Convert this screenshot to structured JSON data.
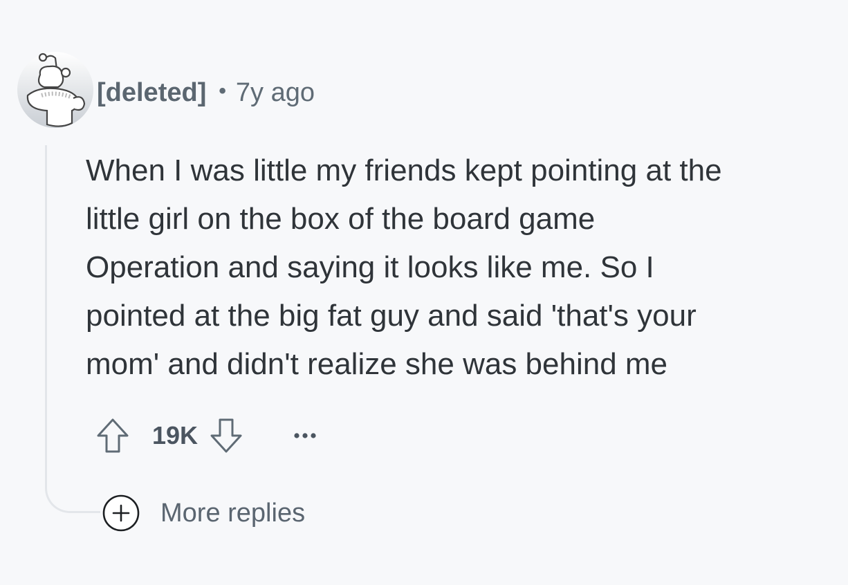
{
  "comment": {
    "author": "[deleted]",
    "separator": "•",
    "timestamp": "7y ago",
    "avatar_icon": "reddit-snoo-deleted-avatar",
    "body_lines": [
      "When I was little my friends kept pointing at the",
      "little girl on the box of the board game",
      "Operation and saying it looks like me. So I",
      "pointed at the big fat guy and said 'that's your",
      "mom' and didn't realize she was behind me"
    ]
  },
  "actions": {
    "upvote_icon": "upvote-arrow-icon",
    "score": "19K",
    "downvote_icon": "downvote-arrow-icon",
    "more_icon": "ellipsis-icon"
  },
  "more_replies": {
    "icon": "plus-circle-icon",
    "label": "More replies"
  },
  "colors": {
    "background": "#f7f8fa",
    "text_primary": "#2f3439",
    "text_secondary": "#5f6b75",
    "thread_line": "#e3e6ea"
  }
}
